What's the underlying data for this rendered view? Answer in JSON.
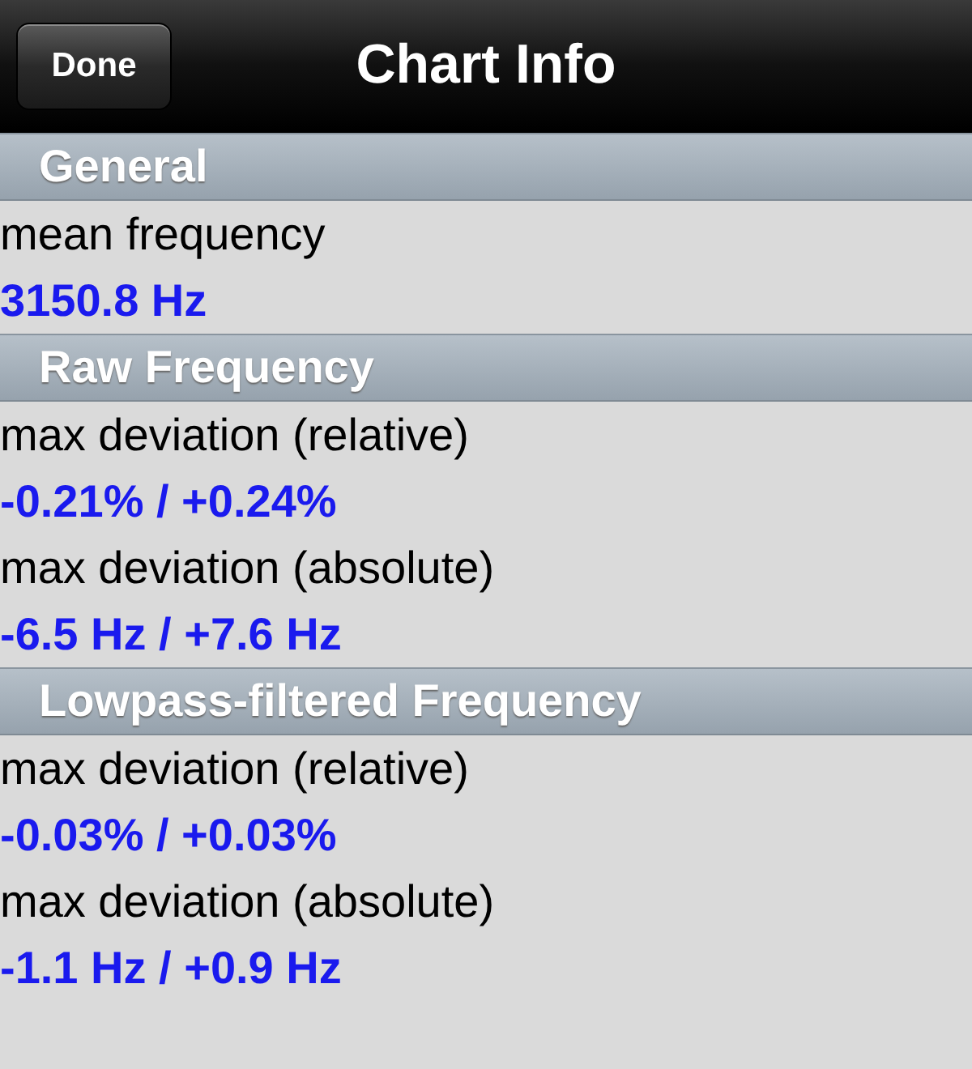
{
  "nav_bar": {
    "done_button": "Done",
    "title": "Chart Info"
  },
  "sections": [
    {
      "title": "General",
      "items": [
        {
          "label": "mean frequency",
          "value": "3150.8 Hz"
        }
      ]
    },
    {
      "title": "Raw Frequency",
      "items": [
        {
          "label": "max deviation (relative)",
          "value": "-0.21% / +0.24%"
        },
        {
          "label": "max deviation (absolute)",
          "value": "-6.5 Hz / +7.6 Hz"
        }
      ]
    },
    {
      "title": "Lowpass-filtered Frequency",
      "items": [
        {
          "label": "max deviation (relative)",
          "value": "-0.03% / +0.03%"
        },
        {
          "label": "max deviation (absolute)",
          "value": "-1.1 Hz / +0.9 Hz"
        }
      ]
    }
  ]
}
